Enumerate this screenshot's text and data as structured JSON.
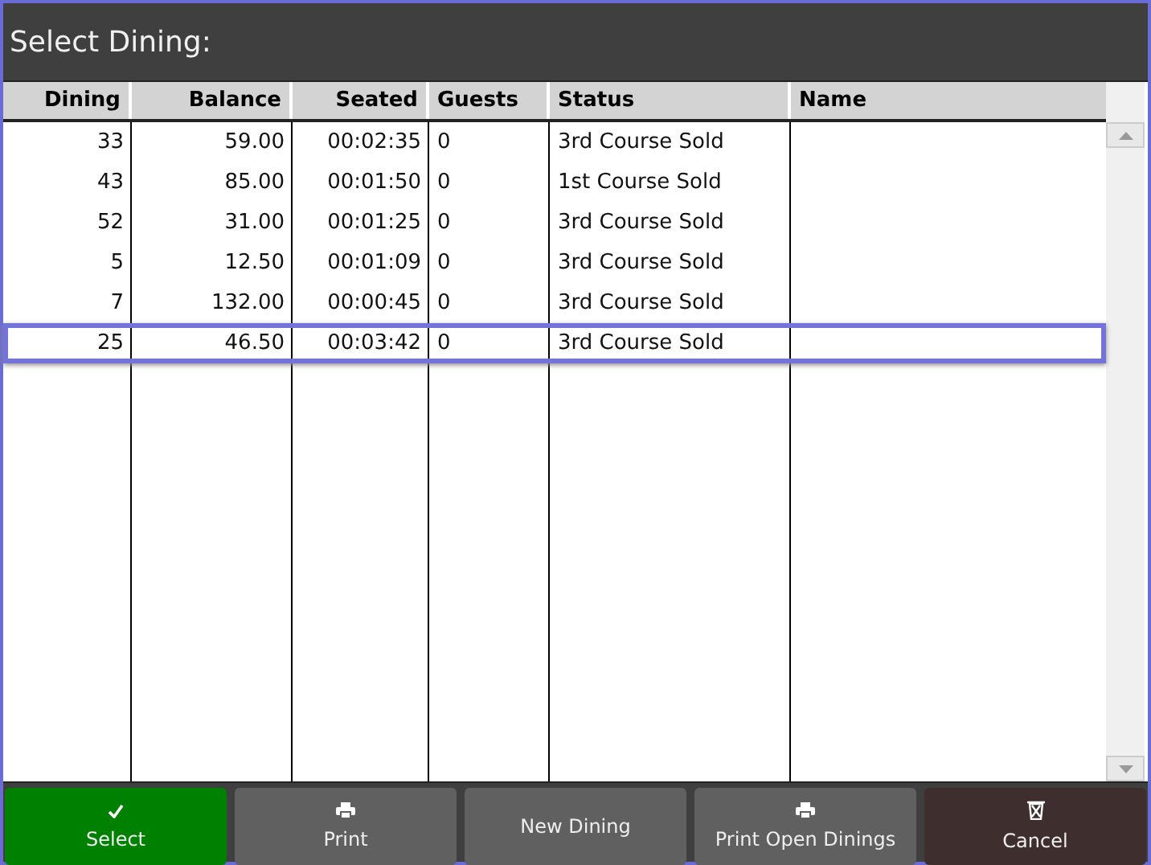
{
  "window": {
    "title": "Select Dining:"
  },
  "table": {
    "columns": [
      "Dining",
      "Balance",
      "Seated",
      "Guests",
      "Status",
      "Name"
    ],
    "rows": [
      {
        "cells": [
          "33",
          "59.00",
          "00:02:35",
          "0",
          "3rd Course Sold",
          ""
        ],
        "selected": false
      },
      {
        "cells": [
          "43",
          "85.00",
          "00:01:50",
          "0",
          "1st Course Sold",
          ""
        ],
        "selected": false
      },
      {
        "cells": [
          "52",
          "31.00",
          "00:01:25",
          "0",
          "3rd Course Sold",
          ""
        ],
        "selected": false
      },
      {
        "cells": [
          "5",
          "12.50",
          "00:01:09",
          "0",
          "3rd Course Sold",
          ""
        ],
        "selected": false
      },
      {
        "cells": [
          "7",
          "132.00",
          "00:00:45",
          "0",
          "3rd Course Sold",
          ""
        ],
        "selected": false
      },
      {
        "cells": [
          "25",
          "46.50",
          "00:03:42",
          "0",
          "3rd Course Sold",
          ""
        ],
        "selected": true
      }
    ]
  },
  "buttons": [
    {
      "label": "Select",
      "kind": "select"
    },
    {
      "label": "Print",
      "kind": "normal"
    },
    {
      "label": "New Dining",
      "kind": "normal"
    },
    {
      "label": "Print Open Dinings",
      "kind": "normal"
    },
    {
      "label": "Cancel",
      "kind": "cancel"
    }
  ]
}
